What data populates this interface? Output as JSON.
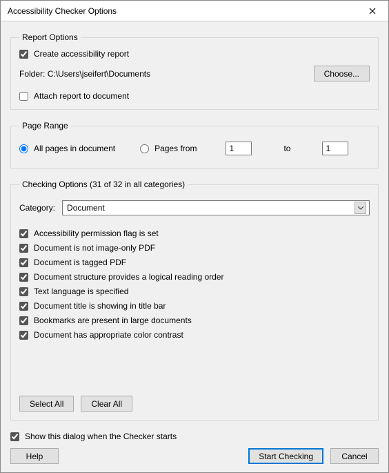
{
  "title": "Accessibility Checker Options",
  "report_options": {
    "legend": "Report Options",
    "create_report": "Create accessibility report",
    "folder_label": "Folder:",
    "folder_path": "C:\\Users\\jseifert\\Documents",
    "choose_btn": "Choose...",
    "attach_report": "Attach report to document"
  },
  "page_range": {
    "legend": "Page Range",
    "all_pages": "All pages in document",
    "pages_from": "Pages from",
    "from_value": "1",
    "to_label": "to",
    "to_value": "1"
  },
  "checking_options": {
    "legend": "Checking Options (31 of 32 in all categories)",
    "category_label": "Category:",
    "category_value": "Document",
    "items": {
      "i0": "Accessibility permission flag is set",
      "i1": "Document is not image-only PDF",
      "i2": "Document is tagged PDF",
      "i3": "Document structure provides a logical reading order",
      "i4": "Text language is specified",
      "i5": "Document title is showing in title bar",
      "i6": "Bookmarks are present in large documents",
      "i7": "Document has appropriate color contrast"
    },
    "select_all": "Select All",
    "clear_all": "Clear All"
  },
  "show_dialog": "Show this dialog when the Checker starts",
  "help_btn": "Help",
  "start_btn": "Start Checking",
  "cancel_btn": "Cancel"
}
